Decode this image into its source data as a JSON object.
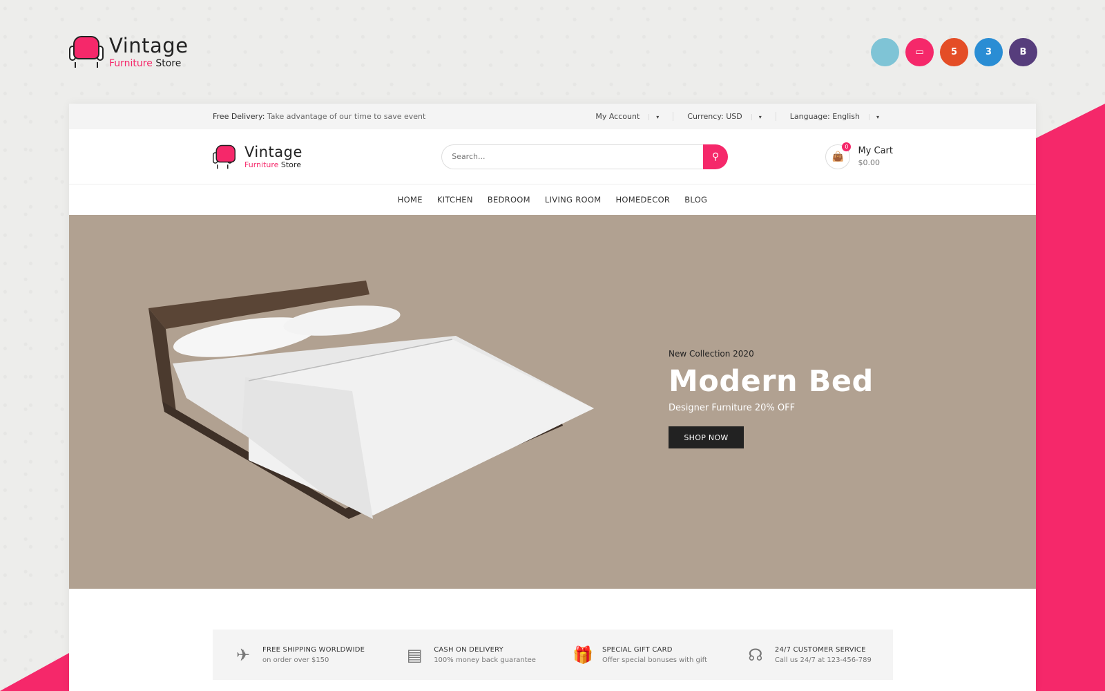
{
  "brand": {
    "name": "Vintage",
    "sub_highlight": "Furniture",
    "sub_rest": "Store"
  },
  "tech_badges": [
    {
      "icon": "prestashop-icon",
      "label": "",
      "color": "#7fc4d6"
    },
    {
      "icon": "responsive-icon",
      "label": "▭",
      "color": "#f5286a"
    },
    {
      "icon": "html5-icon",
      "label": "5",
      "color": "#e44d26"
    },
    {
      "icon": "css3-icon",
      "label": "3",
      "color": "#2a8dd4"
    },
    {
      "icon": "bootstrap-icon",
      "label": "B",
      "color": "#563d7c"
    }
  ],
  "topbar": {
    "delivery_label": "Free Delivery:",
    "delivery_text": "Take advantage of our time to save event",
    "account": "My Account",
    "currency": "Currency: USD",
    "language": "Language: English"
  },
  "search": {
    "placeholder": "Search..."
  },
  "cart": {
    "count": "0",
    "title": "My Cart",
    "total": "$0.00"
  },
  "nav": [
    "HOME",
    "KITCHEN",
    "BEDROOM",
    "LIVING ROOM",
    "HOMEDECOR",
    "BLOG"
  ],
  "hero": {
    "kicker": "New Collection 2020",
    "title": "Modern Bed",
    "subtitle": "Designer Furniture 20% OFF",
    "button": "SHOP NOW",
    "background": "#b1a191"
  },
  "features": [
    {
      "icon": "airplane-icon",
      "glyph": "✈",
      "title": "FREE SHIPPING WORLDWIDE",
      "desc": "on order over $150"
    },
    {
      "icon": "wallet-icon",
      "glyph": "▤",
      "title": "CASH ON DELIVERY",
      "desc": "100% money back guarantee"
    },
    {
      "icon": "gift-icon",
      "glyph": "🎁",
      "title": "SPECIAL GIFT CARD",
      "desc": "Offer special bonuses with gift"
    },
    {
      "icon": "headset-icon",
      "glyph": "☊",
      "title": "24/7 CUSTOMER SERVICE",
      "desc": "Call us 24/7 at 123-456-789"
    }
  ],
  "accent_color": "#f5286a"
}
